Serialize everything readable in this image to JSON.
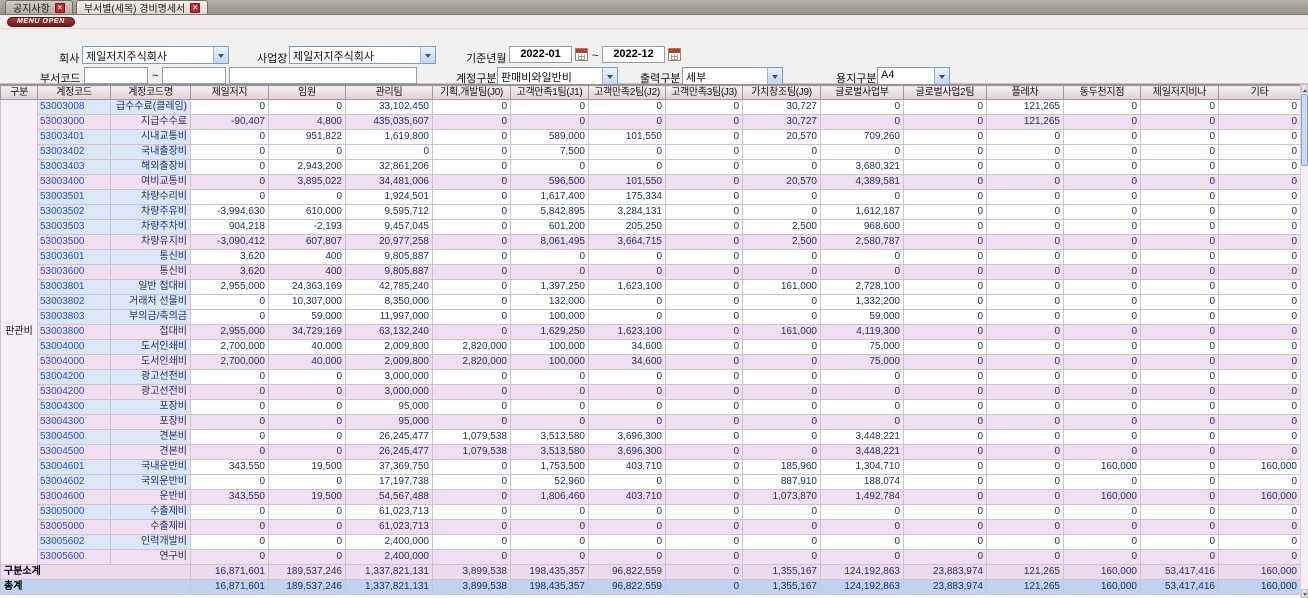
{
  "icons": {
    "close": "×"
  },
  "tabs": [
    {
      "label": "공지사항"
    },
    {
      "label": "부서별(세목) 경비명세서"
    }
  ],
  "menu_open_label": "MENU OPEN",
  "filters": {
    "company_label": "회사",
    "company_value": "제일저지주식회사",
    "worksite_label": "사업장",
    "worksite_value": "제일저지주식회사",
    "base_month_label": "기준년월",
    "base_month_from": "2022-01",
    "base_month_to": "2022-12",
    "tilde": "~",
    "dept_code_label": "부서코드",
    "dept_code_from": "",
    "dept_code_to": "",
    "dept_name": "",
    "account_type_label": "계정구분",
    "account_type_value": "판매비와일반비",
    "output_type_label": "출력구분",
    "output_type_value": "세부",
    "paper_type_label": "용지구분",
    "paper_type_value": "A4"
  },
  "table": {
    "group_label": "판관비",
    "columns": [
      "구분",
      "계정코드",
      "계정코드명",
      "제일저지",
      "임원",
      "관리팀",
      "기획,개발팀(J0)",
      "고객만족1팀(J1)",
      "고객만족2팀(J2)",
      "고객만족3팀(J3)",
      "가치창조팀(J9)",
      "글로벌사업부",
      "글로벌사업2팀",
      "플레차",
      "동두천지점",
      "제일저지비나",
      "기타"
    ],
    "rows": [
      {
        "code": "53003008",
        "name": "급수수료(클레임)",
        "kind": "detail",
        "values": [
          "0",
          "0",
          "33,102,450",
          "0",
          "0",
          "0",
          "0",
          "30,727",
          "0",
          "0",
          "121,265",
          "0",
          "0",
          "0"
        ]
      },
      {
        "code": "53003000",
        "name": "지급수수료",
        "kind": "subtotal",
        "values": [
          "-90,407",
          "4,800",
          "435,035,607",
          "0",
          "0",
          "0",
          "0",
          "30,727",
          "0",
          "0",
          "121,265",
          "0",
          "0",
          "0"
        ]
      },
      {
        "code": "53003401",
        "name": "시내교통비",
        "kind": "detail",
        "values": [
          "0",
          "951,822",
          "1,619,800",
          "0",
          "589,000",
          "101,550",
          "0",
          "20,570",
          "709,260",
          "0",
          "0",
          "0",
          "0",
          "0"
        ]
      },
      {
        "code": "53003402",
        "name": "국내출장비",
        "kind": "detail",
        "values": [
          "0",
          "0",
          "0",
          "0",
          "7,500",
          "0",
          "0",
          "0",
          "0",
          "0",
          "0",
          "0",
          "0",
          "0"
        ]
      },
      {
        "code": "53003403",
        "name": "해외출장비",
        "kind": "detail",
        "values": [
          "0",
          "2,943,200",
          "32,861,206",
          "0",
          "0",
          "0",
          "0",
          "0",
          "3,680,321",
          "0",
          "0",
          "0",
          "0",
          "0"
        ]
      },
      {
        "code": "53003400",
        "name": "여비교통비",
        "kind": "subtotal",
        "values": [
          "0",
          "3,895,022",
          "34,481,006",
          "0",
          "596,500",
          "101,550",
          "0",
          "20,570",
          "4,389,581",
          "0",
          "0",
          "0",
          "0",
          "0"
        ]
      },
      {
        "code": "53003501",
        "name": "차량수리비",
        "kind": "detail",
        "values": [
          "0",
          "0",
          "1,924,501",
          "0",
          "1,617,400",
          "175,334",
          "0",
          "0",
          "0",
          "0",
          "0",
          "0",
          "0",
          "0"
        ]
      },
      {
        "code": "53003502",
        "name": "차량주유비",
        "kind": "detail",
        "values": [
          "-3,994,630",
          "610,000",
          "9,595,712",
          "0",
          "5,842,895",
          "3,284,131",
          "0",
          "0",
          "1,612,187",
          "0",
          "0",
          "0",
          "0",
          "0"
        ]
      },
      {
        "code": "53003503",
        "name": "차량주차비",
        "kind": "detail",
        "values": [
          "904,218",
          "-2,193",
          "9,457,045",
          "0",
          "601,200",
          "205,250",
          "0",
          "2,500",
          "968,600",
          "0",
          "0",
          "0",
          "0",
          "0"
        ]
      },
      {
        "code": "53003500",
        "name": "차량유지비",
        "kind": "subtotal",
        "values": [
          "-3,090,412",
          "607,807",
          "20,977,258",
          "0",
          "8,061,495",
          "3,664,715",
          "0",
          "2,500",
          "2,580,787",
          "0",
          "0",
          "0",
          "0",
          "0"
        ]
      },
      {
        "code": "53003601",
        "name": "통신비",
        "kind": "detail",
        "values": [
          "3,620",
          "400",
          "9,805,887",
          "0",
          "0",
          "0",
          "0",
          "0",
          "0",
          "0",
          "0",
          "0",
          "0",
          "0"
        ]
      },
      {
        "code": "53003600",
        "name": "통신비",
        "kind": "subtotal",
        "values": [
          "3,620",
          "400",
          "9,805,887",
          "0",
          "0",
          "0",
          "0",
          "0",
          "0",
          "0",
          "0",
          "0",
          "0",
          "0"
        ]
      },
      {
        "code": "53003801",
        "name": "일반 접대비",
        "kind": "detail",
        "values": [
          "2,955,000",
          "24,363,169",
          "42,785,240",
          "0",
          "1,397,250",
          "1,623,100",
          "0",
          "161,000",
          "2,728,100",
          "0",
          "0",
          "0",
          "0",
          "0"
        ]
      },
      {
        "code": "53003802",
        "name": "거래처 선물비",
        "kind": "detail",
        "values": [
          "0",
          "10,307,000",
          "8,350,000",
          "0",
          "132,000",
          "0",
          "0",
          "0",
          "1,332,200",
          "0",
          "0",
          "0",
          "0",
          "0"
        ]
      },
      {
        "code": "53003803",
        "name": "부의금/축의금",
        "kind": "detail",
        "values": [
          "0",
          "59,000",
          "11,997,000",
          "0",
          "100,000",
          "0",
          "0",
          "0",
          "59,000",
          "0",
          "0",
          "0",
          "0",
          "0"
        ]
      },
      {
        "code": "53003800",
        "name": "접대비",
        "kind": "subtotal",
        "values": [
          "2,955,000",
          "34,729,169",
          "63,132,240",
          "0",
          "1,629,250",
          "1,623,100",
          "0",
          "161,000",
          "4,119,300",
          "0",
          "0",
          "0",
          "0",
          "0"
        ]
      },
      {
        "code": "53004000",
        "name": "도서인쇄비",
        "kind": "detail",
        "values": [
          "2,700,000",
          "40,000",
          "2,009,800",
          "2,820,000",
          "100,000",
          "34,600",
          "0",
          "0",
          "75,000",
          "0",
          "0",
          "0",
          "0",
          "0"
        ]
      },
      {
        "code": "53004000",
        "name": "도서인쇄비",
        "kind": "subtotal",
        "values": [
          "2,700,000",
          "40,000",
          "2,009,800",
          "2,820,000",
          "100,000",
          "34,600",
          "0",
          "0",
          "75,000",
          "0",
          "0",
          "0",
          "0",
          "0"
        ]
      },
      {
        "code": "53004200",
        "name": "광고선전비",
        "kind": "detail",
        "values": [
          "0",
          "0",
          "3,000,000",
          "0",
          "0",
          "0",
          "0",
          "0",
          "0",
          "0",
          "0",
          "0",
          "0",
          "0"
        ]
      },
      {
        "code": "53004200",
        "name": "광고선전비",
        "kind": "subtotal",
        "values": [
          "0",
          "0",
          "3,000,000",
          "0",
          "0",
          "0",
          "0",
          "0",
          "0",
          "0",
          "0",
          "0",
          "0",
          "0"
        ]
      },
      {
        "code": "53004300",
        "name": "포장비",
        "kind": "detail",
        "values": [
          "0",
          "0",
          "95,000",
          "0",
          "0",
          "0",
          "0",
          "0",
          "0",
          "0",
          "0",
          "0",
          "0",
          "0"
        ]
      },
      {
        "code": "53004300",
        "name": "포장비",
        "kind": "subtotal",
        "values": [
          "0",
          "0",
          "95,000",
          "0",
          "0",
          "0",
          "0",
          "0",
          "0",
          "0",
          "0",
          "0",
          "0",
          "0"
        ]
      },
      {
        "code": "53004500",
        "name": "견본비",
        "kind": "detail",
        "values": [
          "0",
          "0",
          "26,245,477",
          "1,079,538",
          "3,513,580",
          "3,696,300",
          "0",
          "0",
          "3,448,221",
          "0",
          "0",
          "0",
          "0",
          "0"
        ]
      },
      {
        "code": "53004500",
        "name": "견본비",
        "kind": "subtotal",
        "values": [
          "0",
          "0",
          "26,245,477",
          "1,079,538",
          "3,513,580",
          "3,696,300",
          "0",
          "0",
          "3,448,221",
          "0",
          "0",
          "0",
          "0",
          "0"
        ]
      },
      {
        "code": "53004601",
        "name": "국내운반비",
        "kind": "detail",
        "values": [
          "343,550",
          "19,500",
          "37,369,750",
          "0",
          "1,753,500",
          "403,710",
          "0",
          "185,960",
          "1,304,710",
          "0",
          "0",
          "160,000",
          "0",
          "160,000"
        ]
      },
      {
        "code": "53004602",
        "name": "국외운반비",
        "kind": "detail",
        "values": [
          "0",
          "0",
          "17,197,738",
          "0",
          "52,960",
          "0",
          "0",
          "887,910",
          "188,074",
          "0",
          "0",
          "0",
          "0",
          "0"
        ]
      },
      {
        "code": "53004600",
        "name": "운반비",
        "kind": "subtotal",
        "values": [
          "343,550",
          "19,500",
          "54,567,488",
          "0",
          "1,806,460",
          "403,710",
          "0",
          "1,073,870",
          "1,492,784",
          "0",
          "0",
          "160,000",
          "0",
          "160,000"
        ]
      },
      {
        "code": "53005000",
        "name": "수출제비",
        "kind": "detail",
        "values": [
          "0",
          "0",
          "61,023,713",
          "0",
          "0",
          "0",
          "0",
          "0",
          "0",
          "0",
          "0",
          "0",
          "0",
          "0"
        ]
      },
      {
        "code": "53005000",
        "name": "수출제비",
        "kind": "subtotal",
        "values": [
          "0",
          "0",
          "61,023,713",
          "0",
          "0",
          "0",
          "0",
          "0",
          "0",
          "0",
          "0",
          "0",
          "0",
          "0"
        ]
      },
      {
        "code": "53005602",
        "name": "인력개발비",
        "kind": "detail",
        "values": [
          "0",
          "0",
          "2,400,000",
          "0",
          "0",
          "0",
          "0",
          "0",
          "0",
          "0",
          "0",
          "0",
          "0",
          "0"
        ]
      },
      {
        "code": "53005600",
        "name": "연구비",
        "kind": "subtotal",
        "values": [
          "0",
          "0",
          "2,400,000",
          "0",
          "0",
          "0",
          "0",
          "0",
          "0",
          "0",
          "0",
          "0",
          "0",
          "0"
        ]
      }
    ],
    "subtotal_row": {
      "label": "구분소계",
      "values": [
        "16,871,601",
        "189,537,246",
        "1,337,821,131",
        "3,899,538",
        "198,435,357",
        "96,822,559",
        "0",
        "1,355,167",
        "124,192,863",
        "23,883,974",
        "121,265",
        "160,000",
        "53,417,416",
        "160,000"
      ]
    },
    "total_row": {
      "label": "총계",
      "values": [
        "16,871,601",
        "189,537,246",
        "1,337,821,131",
        "3,899,538",
        "198,435,357",
        "96,822,559",
        "0",
        "1,355,167",
        "124,192,863",
        "23,883,974",
        "121,265",
        "160,000",
        "53,417,416",
        "160,000"
      ]
    }
  }
}
